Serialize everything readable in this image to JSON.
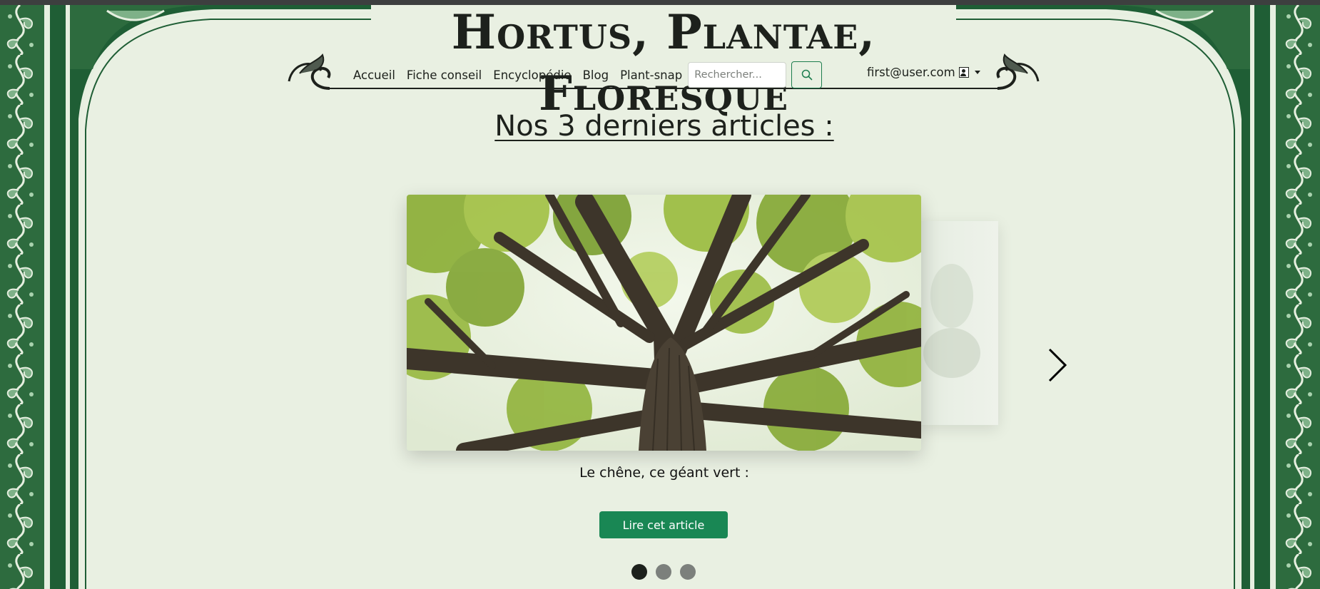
{
  "site": {
    "title": "Hortus, Plantae, Floresque"
  },
  "nav": {
    "links": [
      {
        "label": "Accueil"
      },
      {
        "label": "Fiche conseil"
      },
      {
        "label": "Encyclopédie"
      },
      {
        "label": "Blog"
      },
      {
        "label": "Plant-snap"
      }
    ],
    "search_placeholder": "Rechercher...",
    "search_icon": "search-icon",
    "user_email": "first@user.com",
    "user_icon": "person-square-icon"
  },
  "main": {
    "heading": "Nos 3 derniers articles :",
    "carousel": {
      "active_index": 1,
      "slide_count": 3,
      "caption": "Le chêne, ce géant vert :",
      "button_label": "Lire cet article",
      "next_icon": "chevron-right-icon"
    }
  },
  "colors": {
    "background": "#e9f0e2",
    "frame_green": "#1f5e35",
    "button_green": "#198754",
    "text": "#1d211c"
  }
}
